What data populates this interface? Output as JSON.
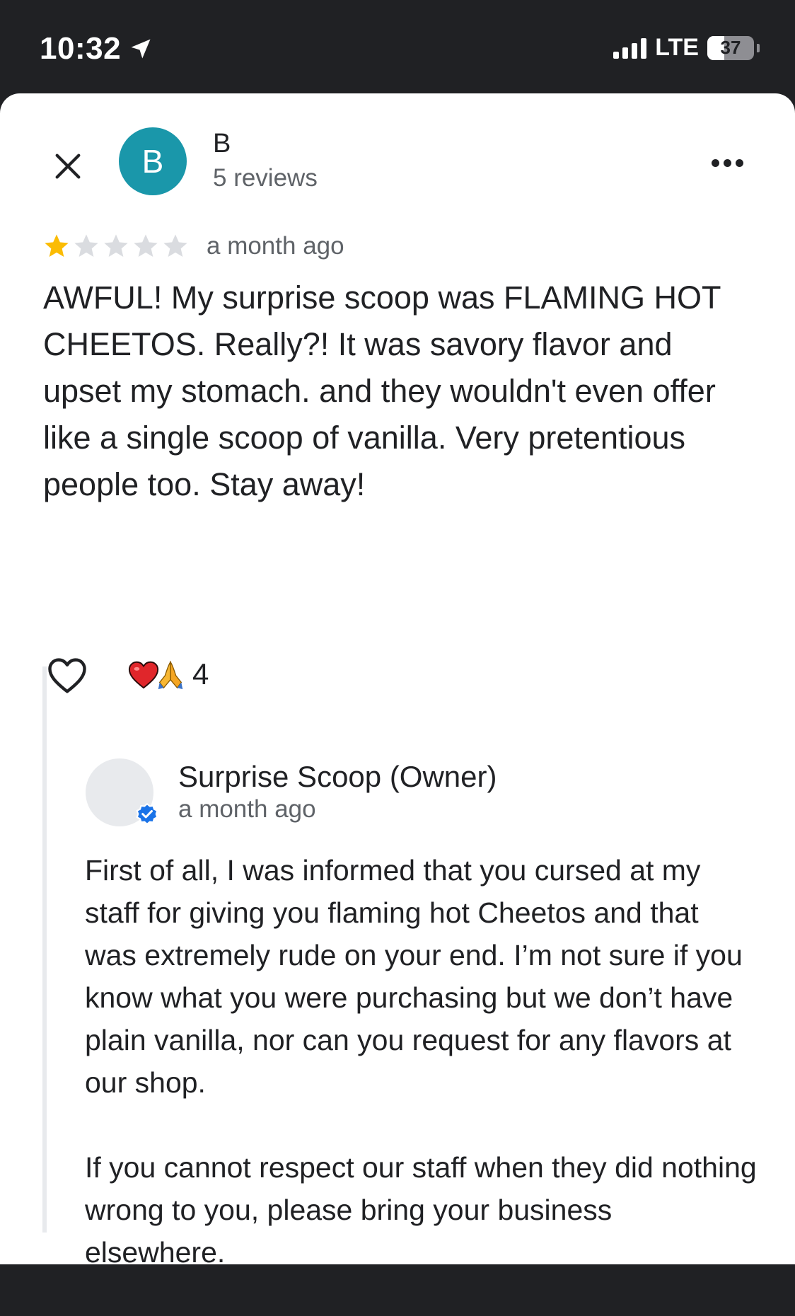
{
  "status_bar": {
    "time": "10:32",
    "network": "LTE",
    "battery": "37",
    "battery_fraction": 0.37
  },
  "header": {
    "close_icon": "close-icon",
    "avatar_letter": "B",
    "avatar_color": "#1a97aa",
    "reviewer_name": "B",
    "reviewer_meta": "5 reviews",
    "more_icon": "more-horizontal-icon"
  },
  "review": {
    "rating": 1,
    "max_rating": 5,
    "star_filled_color": "#fbbc04",
    "star_empty_color": "#dadce0",
    "date": "a month ago",
    "text": "AWFUL! My surprise scoop was FLAMING HOT CHEETOS. Really?! It was savory flavor and upset my stomach. and they wouldn't even offer like a single scoop of vanilla. Very pretentious people too. Stay away!"
  },
  "reactions": {
    "like_icon": "heart-outline-icon",
    "emojis": [
      "red-heart",
      "folded-hands"
    ],
    "count": "4"
  },
  "owner_reply": {
    "name": "Surprise Scoop (Owner)",
    "date": "a month ago",
    "verified_icon": "verified-badge-icon",
    "paragraphs": [
      "First of all, I was informed that you cursed at my staff for giving you flaming hot Cheetos and that was extremely rude on your end. I’m not sure if you know what you were purchasing but we don’t have plain vanilla, nor can you request for any flavors at our shop.",
      "If you cannot respect our staff when they did nothing wrong to you, please bring your business elsewhere."
    ]
  }
}
